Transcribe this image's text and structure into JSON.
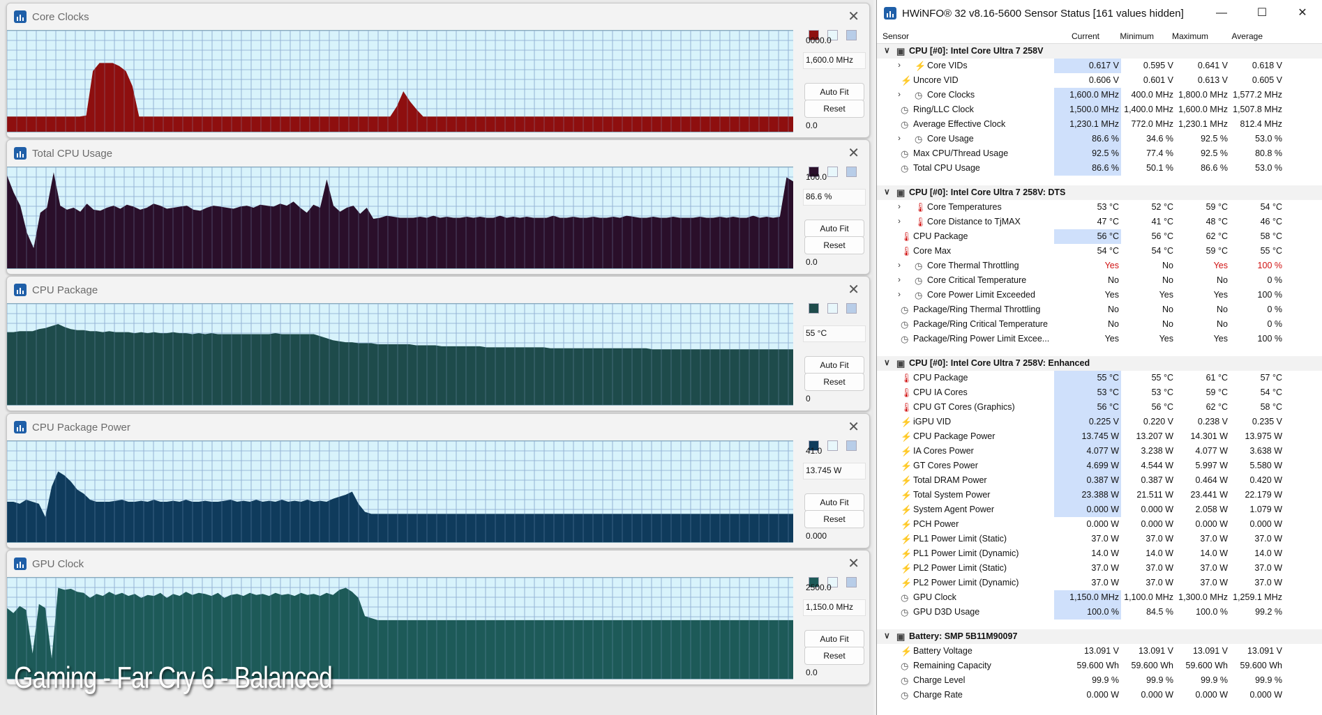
{
  "graphs": [
    {
      "title": "Core Clocks",
      "color": "#8e0f0f",
      "bg": "#d8f3fb",
      "top_label": "0000.0",
      "current_label": "1,600.0 MHz",
      "bottom_label": "0.0",
      "auto_fit": "Auto Fit",
      "reset": "Reset",
      "series": [
        15,
        15,
        15,
        15,
        15,
        15,
        15,
        15,
        15,
        15,
        15,
        15,
        16,
        60,
        68,
        68,
        68,
        65,
        60,
        45,
        15,
        15,
        15,
        15,
        15,
        15,
        15,
        15,
        15,
        15,
        15,
        15,
        15,
        15,
        15,
        15,
        15,
        15,
        15,
        15,
        15,
        15,
        15,
        15,
        15,
        15,
        15,
        15,
        15,
        15,
        15,
        15,
        15,
        15,
        15,
        15,
        15,
        15,
        15,
        25,
        40,
        30,
        22,
        15,
        15,
        15,
        15,
        15,
        15,
        15,
        15,
        15,
        15,
        15,
        15,
        15,
        15,
        15,
        15,
        15,
        15,
        15,
        15,
        15,
        15,
        15,
        15,
        15,
        15,
        15,
        15,
        15,
        15,
        15,
        15,
        15,
        15,
        15,
        15,
        15,
        15,
        15,
        15,
        15,
        15,
        15,
        15,
        15,
        15,
        15,
        15,
        15,
        15,
        15,
        15,
        15,
        15,
        15,
        15,
        15
      ]
    },
    {
      "title": "Total CPU Usage",
      "color": "#2a0f2a",
      "bg": "#d8f3fb",
      "top_label": "100.0",
      "current_label": "86.6 %",
      "bottom_label": "0.0",
      "auto_fit": "Auto Fit",
      "reset": "Reset",
      "series": [
        92,
        75,
        62,
        35,
        20,
        55,
        60,
        95,
        62,
        58,
        60,
        56,
        64,
        58,
        57,
        60,
        62,
        59,
        63,
        61,
        58,
        60,
        64,
        62,
        59,
        60,
        61,
        62,
        58,
        57,
        60,
        62,
        61,
        60,
        59,
        61,
        62,
        60,
        63,
        62,
        61,
        64,
        62,
        66,
        60,
        55,
        63,
        60,
        88,
        62,
        56,
        60,
        62,
        54,
        60,
        49,
        50,
        52,
        51,
        50,
        50,
        50,
        51,
        50,
        52,
        50,
        51,
        50,
        50,
        51,
        50,
        51,
        50,
        50,
        52,
        50,
        51,
        50,
        51,
        50,
        50,
        50,
        52,
        50,
        50,
        51,
        50,
        50,
        51,
        50,
        50,
        51,
        50,
        52,
        51,
        50,
        50,
        51,
        50,
        50,
        51,
        50,
        50,
        50,
        51,
        50,
        50,
        51,
        50,
        51,
        50,
        50,
        52,
        50,
        51,
        50,
        51,
        90,
        86
      ]
    },
    {
      "title": "CPU Package",
      "color": "#1e4b4b",
      "bg": "#d8f3fb",
      "top_label": "",
      "current_label": "55 °C",
      "bottom_label": "0",
      "auto_fit": "Auto Fit",
      "reset": "Reset",
      "series": [
        72,
        72,
        73,
        73,
        73,
        75,
        76,
        78,
        80,
        77,
        75,
        74,
        74,
        73,
        73,
        72,
        73,
        72,
        72,
        72,
        71,
        72,
        71,
        72,
        71,
        71,
        72,
        71,
        71,
        70,
        71,
        70,
        71,
        70,
        70,
        70,
        70,
        70,
        70,
        70,
        70,
        70,
        71,
        70,
        70,
        70,
        70,
        70,
        70,
        68,
        66,
        64,
        63,
        62,
        62,
        61,
        61,
        61,
        60,
        60,
        60,
        60,
        60,
        60,
        59,
        59,
        59,
        59,
        58,
        58,
        58,
        58,
        58,
        58,
        58,
        57,
        57,
        57,
        57,
        57,
        57,
        57,
        57,
        57,
        57,
        56,
        56,
        56,
        56,
        56,
        56,
        56,
        56,
        56,
        56,
        56,
        56,
        56,
        56,
        56,
        56,
        55,
        55,
        55,
        55,
        55,
        55,
        55,
        55,
        55,
        55,
        55,
        55,
        55,
        55,
        55,
        55,
        55,
        55,
        55,
        55,
        55,
        55,
        55
      ]
    },
    {
      "title": "CPU Package Power",
      "color": "#0f3b5c",
      "bg": "#d8f3fb",
      "top_label": "41.0",
      "current_label": "13.745 W",
      "bottom_label": "0.000",
      "auto_fit": "Auto Fit",
      "reset": "Reset",
      "series": [
        40,
        40,
        38,
        42,
        40,
        38,
        25,
        55,
        70,
        66,
        60,
        52,
        48,
        42,
        40,
        40,
        40,
        41,
        42,
        40,
        40,
        41,
        40,
        42,
        40,
        40,
        41,
        40,
        42,
        40,
        40,
        41,
        40,
        40,
        41,
        42,
        40,
        41,
        40,
        42,
        40,
        41,
        40,
        42,
        40,
        41,
        40,
        42,
        40,
        41,
        40,
        43,
        45,
        47,
        50,
        38,
        30,
        28,
        28,
        28,
        28,
        28,
        28,
        28,
        28,
        28,
        28,
        28,
        28,
        28,
        28,
        28,
        28,
        28,
        28,
        28,
        28,
        28,
        28,
        28,
        28,
        28,
        28,
        28,
        28,
        28,
        28,
        28,
        28,
        28,
        28,
        28,
        28,
        28,
        28,
        28,
        28,
        28,
        28,
        28,
        28,
        28,
        28,
        28,
        28,
        28,
        28,
        28,
        28,
        28,
        28,
        28,
        28,
        28,
        28,
        28,
        28,
        28,
        28,
        28,
        28,
        28,
        28,
        28
      ]
    },
    {
      "title": "GPU Clock",
      "color": "#1d5a58",
      "bg": "#d8f3fb",
      "top_label": "2500.0",
      "current_label": "1,150.0 MHz",
      "bottom_label": "0.0",
      "auto_fit": "Auto Fit",
      "reset": "Reset",
      "series": [
        70,
        65,
        72,
        68,
        25,
        74,
        70,
        20,
        90,
        88,
        89,
        86,
        85,
        80,
        84,
        82,
        86,
        83,
        85,
        82,
        84,
        80,
        83,
        82,
        85,
        80,
        84,
        82,
        86,
        83,
        85,
        84,
        82,
        85,
        80,
        83,
        84,
        82,
        85,
        83,
        84,
        82,
        85,
        83,
        84,
        82,
        85,
        83,
        84,
        82,
        85,
        83,
        88,
        90,
        86,
        80,
        62,
        60,
        58,
        58,
        58,
        58,
        58,
        58,
        58,
        58,
        58,
        58,
        58,
        58,
        58,
        58,
        58,
        58,
        58,
        58,
        58,
        58,
        58,
        58,
        58,
        58,
        58,
        58,
        58,
        58,
        58,
        58,
        58,
        58,
        58,
        58,
        58,
        58,
        58,
        58,
        58,
        58,
        58,
        58,
        58,
        58,
        58,
        58,
        58,
        58,
        58,
        58,
        58,
        58,
        58,
        58,
        58,
        58,
        58,
        58,
        58,
        58,
        58,
        58,
        58,
        58,
        58,
        58
      ]
    }
  ],
  "overlay_text": "Gaming - Far Cry 6 - Balanced",
  "hwinfo": {
    "title": "HWiNFO® 32 v8.16-5600 Sensor Status [161 values hidden]",
    "columns": {
      "sensor": "Sensor",
      "current": "Current",
      "minimum": "Minimum",
      "maximum": "Maximum",
      "average": "Average"
    },
    "rows": [
      {
        "type": "group",
        "name": "CPU [#0]: Intel Core Ultra 7 258V"
      },
      {
        "type": "item",
        "expand": true,
        "icon": "bolt",
        "name": "Core VIDs",
        "cur": "0.617 V",
        "min": "0.595 V",
        "max": "0.641 V",
        "avg": "0.618 V",
        "hl": true
      },
      {
        "type": "item",
        "icon": "bolt",
        "name": "Uncore VID",
        "cur": "0.606 V",
        "min": "0.601 V",
        "max": "0.613 V",
        "avg": "0.605 V"
      },
      {
        "type": "item",
        "expand": true,
        "icon": "clock",
        "name": "Core Clocks",
        "cur": "1,600.0 MHz",
        "min": "400.0 MHz",
        "max": "1,800.0 MHz",
        "avg": "1,577.2 MHz",
        "hl": true
      },
      {
        "type": "item",
        "icon": "clock",
        "name": "Ring/LLC Clock",
        "cur": "1,500.0 MHz",
        "min": "1,400.0 MHz",
        "max": "1,600.0 MHz",
        "avg": "1,507.8 MHz",
        "hl": true
      },
      {
        "type": "item",
        "icon": "clock",
        "name": "Average Effective Clock",
        "cur": "1,230.1 MHz",
        "min": "772.0 MHz",
        "max": "1,230.1 MHz",
        "avg": "812.4 MHz",
        "hl": true
      },
      {
        "type": "item",
        "expand": true,
        "icon": "clock",
        "name": "Core Usage",
        "cur": "86.6 %",
        "min": "34.6 %",
        "max": "92.5 %",
        "avg": "53.0 %",
        "hl": true
      },
      {
        "type": "item",
        "icon": "clock",
        "name": "Max CPU/Thread Usage",
        "cur": "92.5 %",
        "min": "77.4 %",
        "max": "92.5 %",
        "avg": "80.8 %",
        "hl": true
      },
      {
        "type": "item",
        "icon": "clock",
        "name": "Total CPU Usage",
        "cur": "86.6 %",
        "min": "50.1 %",
        "max": "86.6 %",
        "avg": "53.0 %",
        "hl": true
      },
      {
        "type": "spacer"
      },
      {
        "type": "group",
        "name": "CPU [#0]: Intel Core Ultra 7 258V: DTS"
      },
      {
        "type": "item",
        "expand": true,
        "icon": "temp",
        "name": "Core Temperatures",
        "cur": "53 °C",
        "min": "52 °C",
        "max": "59 °C",
        "avg": "54 °C"
      },
      {
        "type": "item",
        "expand": true,
        "icon": "temp",
        "name": "Core Distance to TjMAX",
        "cur": "47 °C",
        "min": "41 °C",
        "max": "48 °C",
        "avg": "46 °C"
      },
      {
        "type": "item",
        "icon": "temp",
        "name": "CPU Package",
        "cur": "56 °C",
        "min": "56 °C",
        "max": "62 °C",
        "avg": "58 °C",
        "hl": true
      },
      {
        "type": "item",
        "icon": "temp",
        "name": "Core Max",
        "cur": "54 °C",
        "min": "54 °C",
        "max": "59 °C",
        "avg": "55 °C"
      },
      {
        "type": "item",
        "expand": true,
        "icon": "clock",
        "name": "Core Thermal Throttling",
        "cur": "Yes",
        "min": "No",
        "max": "Yes",
        "avg": "100 %",
        "red": true
      },
      {
        "type": "item",
        "expand": true,
        "icon": "clock",
        "name": "Core Critical Temperature",
        "cur": "No",
        "min": "No",
        "max": "No",
        "avg": "0 %"
      },
      {
        "type": "item",
        "expand": true,
        "icon": "clock",
        "name": "Core Power Limit Exceeded",
        "cur": "Yes",
        "min": "Yes",
        "max": "Yes",
        "avg": "100 %"
      },
      {
        "type": "item",
        "icon": "clock",
        "name": "Package/Ring Thermal Throttling",
        "cur": "No",
        "min": "No",
        "max": "No",
        "avg": "0 %"
      },
      {
        "type": "item",
        "icon": "clock",
        "name": "Package/Ring Critical Temperature",
        "cur": "No",
        "min": "No",
        "max": "No",
        "avg": "0 %"
      },
      {
        "type": "item",
        "icon": "clock",
        "name": "Package/Ring Power Limit Excee...",
        "cur": "Yes",
        "min": "Yes",
        "max": "Yes",
        "avg": "100 %"
      },
      {
        "type": "spacer"
      },
      {
        "type": "group",
        "name": "CPU [#0]: Intel Core Ultra 7 258V: Enhanced"
      },
      {
        "type": "item",
        "icon": "temp",
        "name": "CPU Package",
        "cur": "55 °C",
        "min": "55 °C",
        "max": "61 °C",
        "avg": "57 °C",
        "hl": true
      },
      {
        "type": "item",
        "icon": "temp",
        "name": "CPU IA Cores",
        "cur": "53 °C",
        "min": "53 °C",
        "max": "59 °C",
        "avg": "54 °C",
        "hl": true
      },
      {
        "type": "item",
        "icon": "temp",
        "name": "CPU GT Cores (Graphics)",
        "cur": "56 °C",
        "min": "56 °C",
        "max": "62 °C",
        "avg": "58 °C",
        "hl": true
      },
      {
        "type": "item",
        "icon": "bolt",
        "name": "iGPU VID",
        "cur": "0.225 V",
        "min": "0.220 V",
        "max": "0.238 V",
        "avg": "0.235 V",
        "hl": true
      },
      {
        "type": "item",
        "icon": "bolt",
        "name": "CPU Package Power",
        "cur": "13.745 W",
        "min": "13.207 W",
        "max": "14.301 W",
        "avg": "13.975 W",
        "hl": true
      },
      {
        "type": "item",
        "icon": "bolt",
        "name": "IA Cores Power",
        "cur": "4.077 W",
        "min": "3.238 W",
        "max": "4.077 W",
        "avg": "3.638 W",
        "hl": true
      },
      {
        "type": "item",
        "icon": "bolt",
        "name": "GT Cores Power",
        "cur": "4.699 W",
        "min": "4.544 W",
        "max": "5.997 W",
        "avg": "5.580 W",
        "hl": true
      },
      {
        "type": "item",
        "icon": "bolt",
        "name": "Total DRAM Power",
        "cur": "0.387 W",
        "min": "0.387 W",
        "max": "0.464 W",
        "avg": "0.420 W",
        "hl": true
      },
      {
        "type": "item",
        "icon": "bolt",
        "name": "Total System Power",
        "cur": "23.388 W",
        "min": "21.511 W",
        "max": "23.441 W",
        "avg": "22.179 W",
        "hl": true
      },
      {
        "type": "item",
        "icon": "bolt",
        "name": "System Agent Power",
        "cur": "0.000 W",
        "min": "0.000 W",
        "max": "2.058 W",
        "avg": "1.079 W",
        "hl": true
      },
      {
        "type": "item",
        "icon": "bolt",
        "name": "PCH Power",
        "cur": "0.000 W",
        "min": "0.000 W",
        "max": "0.000 W",
        "avg": "0.000 W"
      },
      {
        "type": "item",
        "icon": "bolt",
        "name": "PL1 Power Limit (Static)",
        "cur": "37.0 W",
        "min": "37.0 W",
        "max": "37.0 W",
        "avg": "37.0 W"
      },
      {
        "type": "item",
        "icon": "bolt",
        "name": "PL1 Power Limit (Dynamic)",
        "cur": "14.0 W",
        "min": "14.0 W",
        "max": "14.0 W",
        "avg": "14.0 W"
      },
      {
        "type": "item",
        "icon": "bolt",
        "name": "PL2 Power Limit (Static)",
        "cur": "37.0 W",
        "min": "37.0 W",
        "max": "37.0 W",
        "avg": "37.0 W"
      },
      {
        "type": "item",
        "icon": "bolt",
        "name": "PL2 Power Limit (Dynamic)",
        "cur": "37.0 W",
        "min": "37.0 W",
        "max": "37.0 W",
        "avg": "37.0 W"
      },
      {
        "type": "item",
        "icon": "clock",
        "name": "GPU Clock",
        "cur": "1,150.0 MHz",
        "min": "1,100.0 MHz",
        "max": "1,300.0 MHz",
        "avg": "1,259.1 MHz",
        "hl": true
      },
      {
        "type": "item",
        "icon": "clock",
        "name": "GPU D3D Usage",
        "cur": "100.0 %",
        "min": "84.5 %",
        "max": "100.0 %",
        "avg": "99.2 %",
        "hl": true
      },
      {
        "type": "spacer"
      },
      {
        "type": "group",
        "name": "Battery: SMP 5B11M90097"
      },
      {
        "type": "item",
        "icon": "bolt",
        "name": "Battery Voltage",
        "cur": "13.091 V",
        "min": "13.091 V",
        "max": "13.091 V",
        "avg": "13.091 V"
      },
      {
        "type": "item",
        "icon": "clock",
        "name": "Remaining Capacity",
        "cur": "59.600 Wh",
        "min": "59.600 Wh",
        "max": "59.600 Wh",
        "avg": "59.600 Wh"
      },
      {
        "type": "item",
        "icon": "clock",
        "name": "Charge Level",
        "cur": "99.9 %",
        "min": "99.9 %",
        "max": "99.9 %",
        "avg": "99.9 %"
      },
      {
        "type": "item",
        "icon": "clock",
        "name": "Charge Rate",
        "cur": "0.000 W",
        "min": "0.000 W",
        "max": "0.000 W",
        "avg": "0.000 W"
      }
    ]
  }
}
